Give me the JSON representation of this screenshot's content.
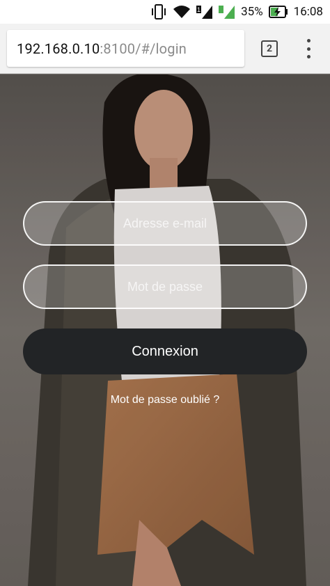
{
  "status_bar": {
    "battery_percent": "35%",
    "time": "16:08",
    "sim2_label": "2",
    "icons": [
      "vibrate-icon",
      "wifi-icon",
      "signal-sim1-icon",
      "signal-sim2-icon",
      "battery-charging-icon"
    ]
  },
  "browser": {
    "url_host": "192.168.0.10",
    "url_path": ":8100/#/login",
    "tab_count": "2",
    "menu_icon": "overflow-menu-icon"
  },
  "login": {
    "email_placeholder": "Adresse e-mail",
    "email_value": "",
    "password_placeholder": "Mot de passe",
    "password_value": "",
    "submit_label": "Connexion",
    "forgot_password_label": "Mot de passe oublié ?"
  },
  "colors": {
    "button_bg": "#222426",
    "field_border": "#ffffff",
    "toolbar_bg": "#f2f2f2",
    "battery_charging": "#4caf50",
    "sim2_signal": "#4caf50"
  }
}
